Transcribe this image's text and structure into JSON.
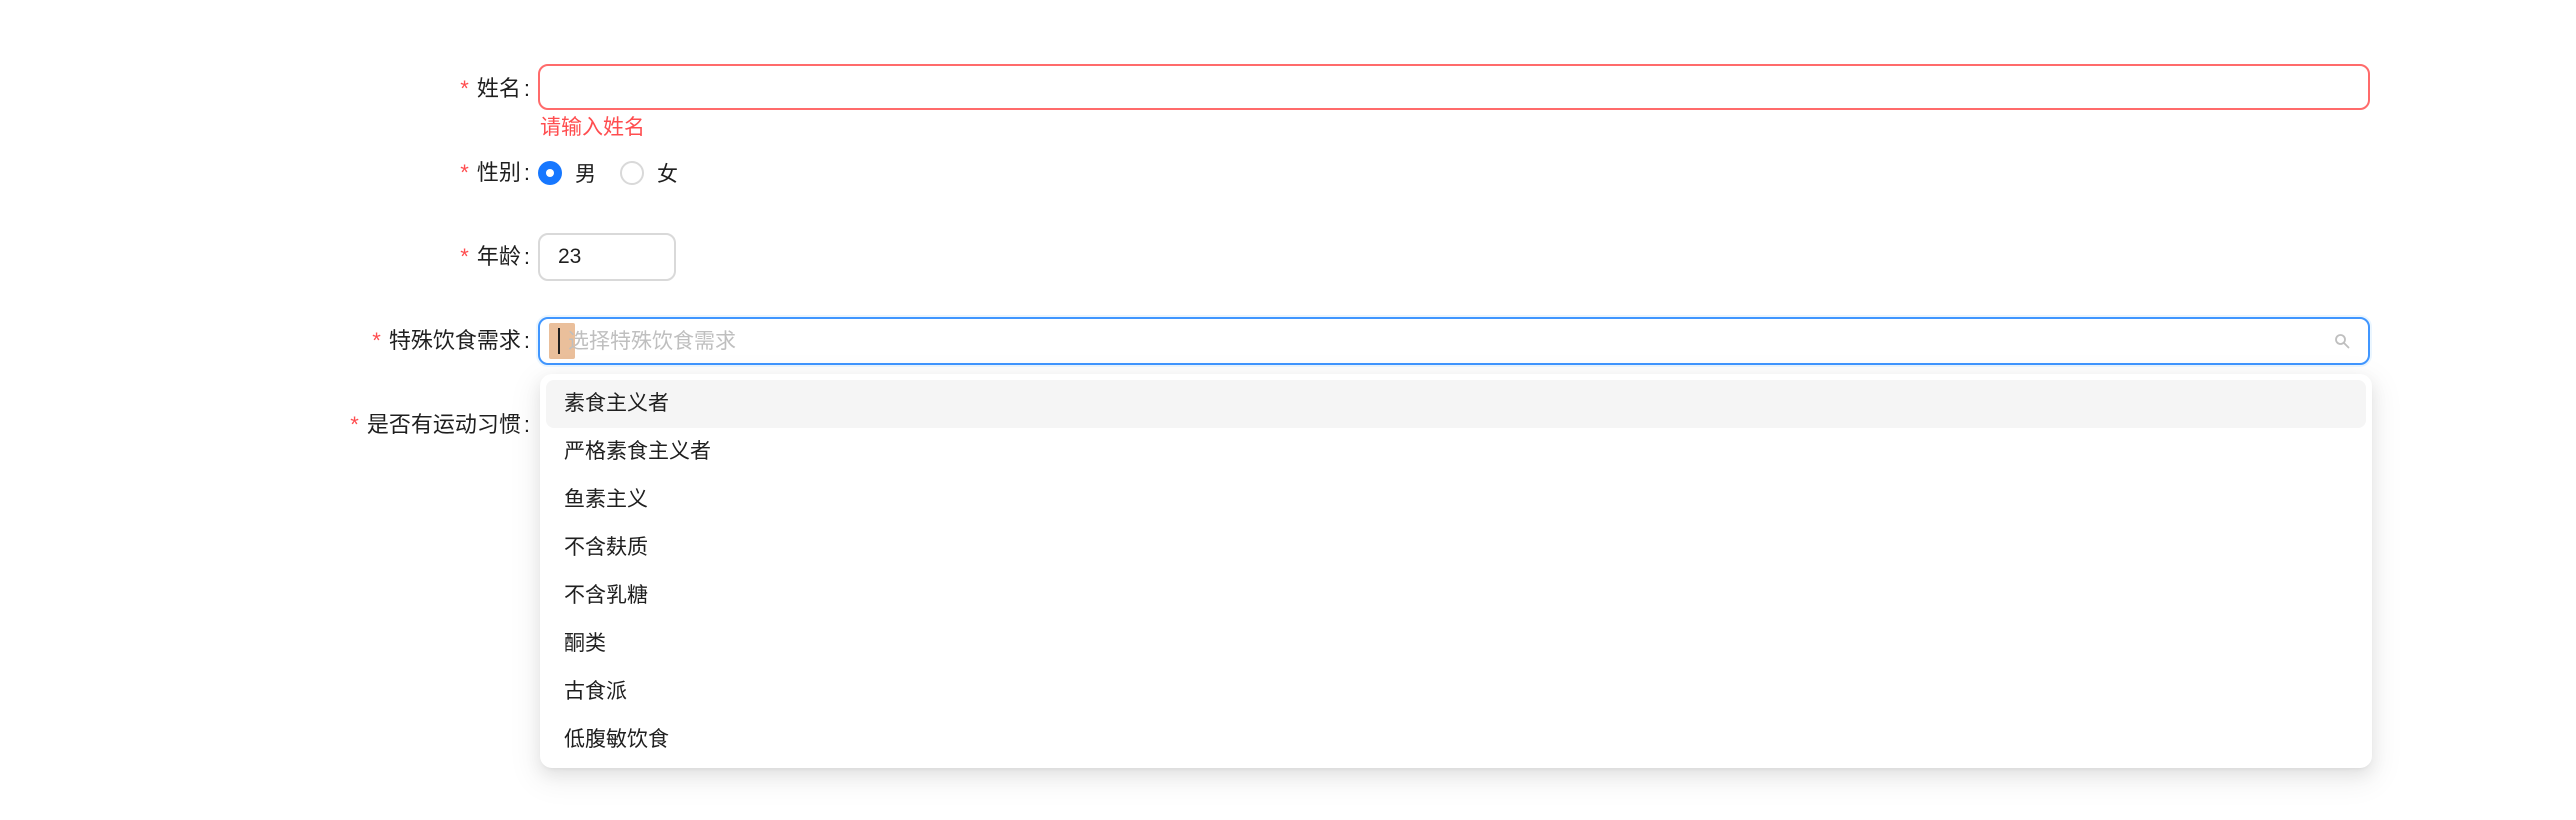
{
  "form": {
    "name": {
      "label": "姓名",
      "value": "",
      "error": "请输入姓名"
    },
    "gender": {
      "label": "性别",
      "options": [
        "男",
        "女"
      ],
      "selected": "男"
    },
    "age": {
      "label": "年龄",
      "value": "23"
    },
    "diet": {
      "label": "特殊饮食需求",
      "placeholder": "请选择特殊饮食需求",
      "placeholder_visible": "选择特殊饮食需求",
      "options": [
        "素食主义者",
        "严格素食主义者",
        "鱼素主义",
        "不含麸质",
        "不含乳糖",
        "酮类",
        "古食派",
        "低腹敏饮食"
      ],
      "highlighted": "素食主义者"
    },
    "exercise": {
      "label": "是否有运动习惯"
    },
    "required_mark": "*",
    "colon": ":"
  },
  "icons": {
    "diet_select": "search-icon"
  },
  "colors": {
    "required": "#ff4d4f",
    "error_border": "#ff6b6b",
    "focus_border": "#4096ff",
    "radio_checked": "#1677ff"
  }
}
